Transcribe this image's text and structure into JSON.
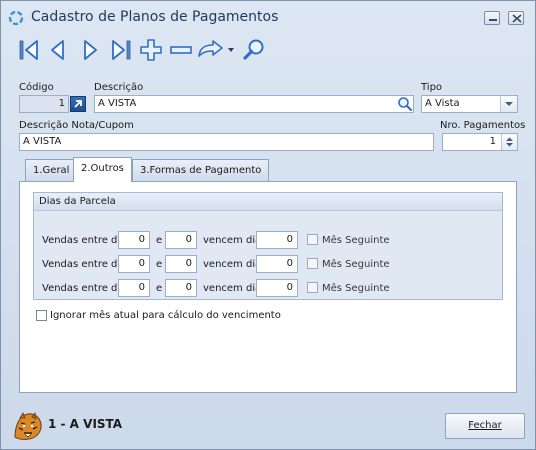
{
  "window": {
    "title": "Cadastro de Planos de Pagamentos"
  },
  "toolbar": {
    "icons": [
      "first-record-icon",
      "previous-record-icon",
      "next-record-icon",
      "last-record-icon",
      "add-icon",
      "remove-icon",
      "refresh-icon",
      "dropdown-arrow-icon",
      "search-icon"
    ]
  },
  "form": {
    "codigo_label": "Código",
    "codigo_value": "1",
    "descricao_label": "Descrição",
    "descricao_value": "A VISTA",
    "tipo_label": "Tipo",
    "tipo_value": "A Vista",
    "descricao_nota_label": "Descrição Nota/Cupom",
    "descricao_nota_value": "A VISTA",
    "nro_pagamentos_label": "Nro. Pagamentos",
    "nro_pagamentos_value": "1"
  },
  "tabs": [
    {
      "label": "1.Geral",
      "active": false
    },
    {
      "label": "2.Outros",
      "active": true
    },
    {
      "label": "3.Formas de Pagamento",
      "active": false
    }
  ],
  "dias_parcela": {
    "title": "Dias da Parcela",
    "rows": [
      {
        "prefix": "Vendas entre dia",
        "from": "0",
        "conj": "e",
        "to": "0",
        "mid": "vencem dia",
        "day": "0",
        "check_label": "Mês Seguinte",
        "checked": false
      },
      {
        "prefix": "Vendas entre dia",
        "from": "0",
        "conj": "e",
        "to": "0",
        "mid": "vencem dia",
        "day": "0",
        "check_label": "Mês Seguinte",
        "checked": false
      },
      {
        "prefix": "Vendas entre dia",
        "from": "0",
        "conj": "e",
        "to": "0",
        "mid": "vencem dia",
        "day": "0",
        "check_label": "Mês Seguinte",
        "checked": false
      }
    ]
  },
  "ignorar": {
    "label": "Ignorar mês atual para cálculo do vencimento",
    "checked": false
  },
  "footer": {
    "record_label": "1 - A VISTA",
    "close_label": "Fechar"
  },
  "colors": {
    "window_bg": "#d3dfee",
    "accent_blue": "#2f6fc8",
    "panel_border": "#8ea3bf"
  }
}
